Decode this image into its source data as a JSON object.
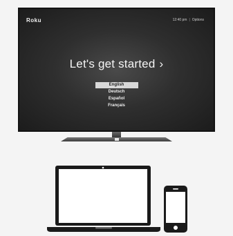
{
  "brand": {
    "logo_text": "Roku"
  },
  "status_bar": {
    "time": "12:40 pm",
    "separator": "|",
    "options_label": "Options"
  },
  "setup": {
    "title": "Let's get started",
    "chevron": "›",
    "languages": [
      {
        "label": "English",
        "selected": true
      },
      {
        "label": "Deutsch",
        "selected": false
      },
      {
        "label": "Español",
        "selected": false
      },
      {
        "label": "Français",
        "selected": false
      }
    ]
  },
  "colors": {
    "screen_bg": "#2f2f2f",
    "selection_bg": "#d8d8d8",
    "page_bg": "#f4f4f4"
  },
  "icons": [
    "laptop-icon",
    "smartphone-icon"
  ]
}
